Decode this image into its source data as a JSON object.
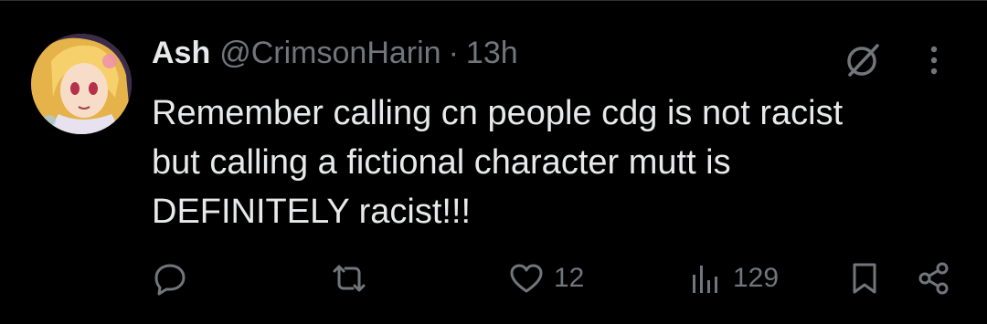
{
  "post": {
    "author_name": "Ash",
    "author_handle": "@CrimsonHarin",
    "separator": "·",
    "time": "13h",
    "text_lines": [
      "Remember calling cn people cdg is not racist",
      "but calling a fictional character mutt is",
      "DEFINITELY racist!!!"
    ]
  },
  "actions": {
    "reply_icon": "reply-icon",
    "repost_icon": "repost-icon",
    "like_icon": "heart-icon",
    "like_count": "12",
    "views_icon": "bar-chart-icon",
    "views_count": "129",
    "bookmark_icon": "bookmark-icon",
    "share_icon": "share-icon"
  },
  "header_icons": {
    "grok": "grok-icon",
    "more": "more-vertical-icon"
  },
  "colors": {
    "background": "#000000",
    "text_primary": "#e7e9ea",
    "text_secondary": "#71767b",
    "divider": "#2f3336"
  }
}
